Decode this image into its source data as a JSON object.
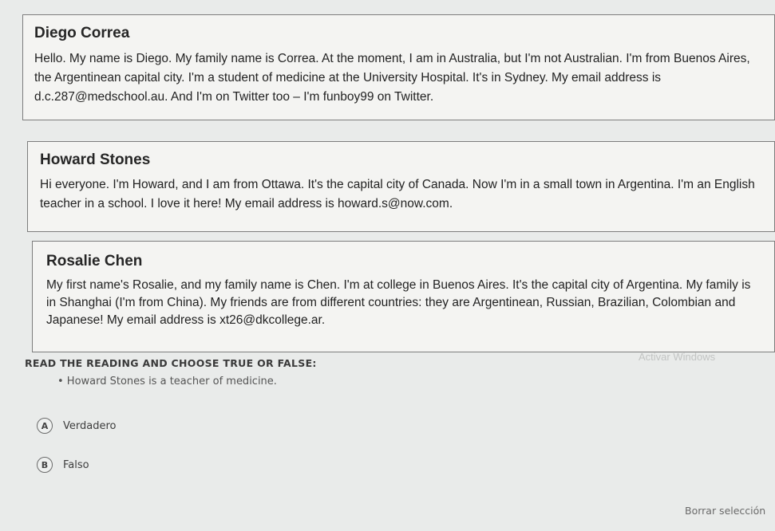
{
  "profiles": [
    {
      "name": "Diego Correa",
      "text": "Hello. My name is Diego. My family name is Correa. At the moment, I am in Australia, but I'm not Australian. I'm from Buenos Aires, the Argentinean capital city. I'm a student of medicine at the University Hospital. It's in Sydney. My email address is d.c.287@medschool.au. And I'm on Twitter too – I'm funboy99 on Twitter."
    },
    {
      "name": "Howard Stones",
      "text": "Hi everyone. I'm Howard, and I am from Ottawa. It's the capital city of Canada. Now I'm in a small town in Argentina. I'm an English teacher in a school. I love it here! My email address is howard.s@now.com."
    },
    {
      "name": "Rosalie Chen",
      "text": "My first name's Rosalie, and my family name is Chen. I'm at college in Buenos Aires. It's the capital city of Argentina. My family is in Shanghai (I'm from China). My friends are from different countries: they are Argentinean, Russian, Brazilian, Colombian and Japanese! My email address is xt26@dkcollege.ar."
    }
  ],
  "question": {
    "instruction": "READ THE READING AND CHOOSE TRUE OR FALSE:",
    "statement": "• Howard Stones is a teacher of medicine.",
    "options": [
      {
        "letter": "A",
        "label": "Verdadero"
      },
      {
        "letter": "B",
        "label": "Falso"
      }
    ],
    "clear_label": "Borrar selección"
  },
  "watermark": "Activar Windows"
}
